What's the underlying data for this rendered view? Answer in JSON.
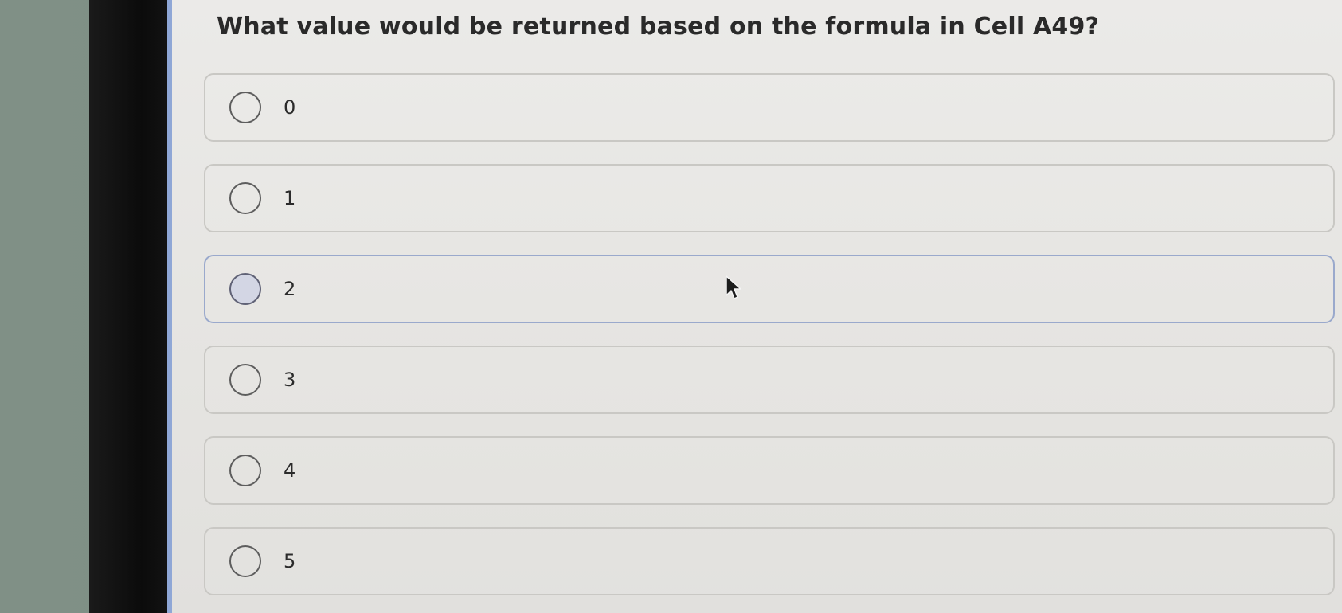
{
  "question": {
    "text": "What value would be returned based on the formula in Cell A49?"
  },
  "options": [
    {
      "label": "0",
      "hovered": false
    },
    {
      "label": "1",
      "hovered": false
    },
    {
      "label": "2",
      "hovered": true
    },
    {
      "label": "3",
      "hovered": false
    },
    {
      "label": "4",
      "hovered": false
    },
    {
      "label": "5",
      "hovered": false
    }
  ],
  "colors": {
    "screen_bg": "#e6e5e2",
    "option_border": "#c9c8c4",
    "hover_border": "#9aa9cc",
    "accent_left_bar": "#8fa7d6",
    "text": "#2a2a2a"
  },
  "icons": {
    "pointer": "mouse-pointer-icon",
    "radio": "radio-circle-icon"
  }
}
